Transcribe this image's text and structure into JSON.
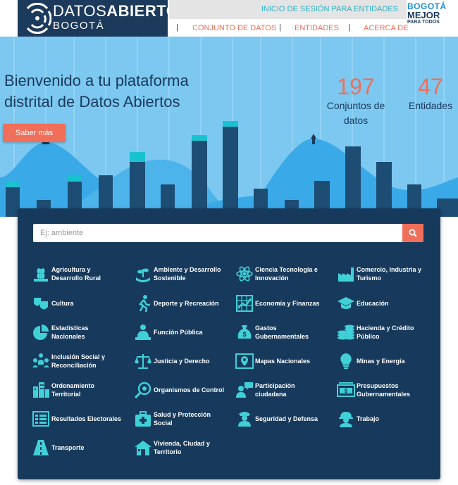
{
  "header": {
    "logo_line1_regular": "DATOS",
    "logo_line1_bold": "ABIERTOS",
    "logo_line2": "BOGOTÁ",
    "login_link": "INICIO DE SESIÓN PARA ENTIDADES",
    "nav": [
      "CONJUNTO DE DATOS",
      "ENTIDADES",
      "ACERCA DE"
    ],
    "badge": {
      "line1": "BOGOTÁ",
      "line2": "MEJOR",
      "line3": "PARA TODOS"
    }
  },
  "hero": {
    "title_line1": "Bienvenido a tu plataforma",
    "title_line2": "distrital de Datos Abiertos",
    "cta_label": "Saber más",
    "stats": [
      {
        "number": "197",
        "label_line1": "Conjuntos de",
        "label_line2": "datos"
      },
      {
        "number": "47",
        "label_line1": "Entidades",
        "label_line2": ""
      }
    ]
  },
  "search": {
    "placeholder": "Ej: ambiente"
  },
  "categories": [
    {
      "l1": "Agricultura y",
      "l2": "Desarrollo Rural",
      "icon": "wheat-icon"
    },
    {
      "l1": "Ambiente y Desarrollo",
      "l2": "Sostenible",
      "icon": "plant-hands-icon"
    },
    {
      "l1": "Ciencia Tecnología e",
      "l2": "Innovación",
      "icon": "atom-icon"
    },
    {
      "l1": "Comercio, Industria y",
      "l2": "Turismo",
      "icon": "factory-icon"
    },
    {
      "l1": "Cultura",
      "l2": "",
      "icon": "theater-masks-icon"
    },
    {
      "l1": "Deporte y Recreación",
      "l2": "",
      "icon": "runner-icon"
    },
    {
      "l1": "Economía y Finanzas",
      "l2": "",
      "icon": "grid-chart-icon"
    },
    {
      "l1": "Educación",
      "l2": "",
      "icon": "graduation-cap-icon"
    },
    {
      "l1": "Estadísticas",
      "l2": "Nacionales",
      "icon": "pie-chart-icon"
    },
    {
      "l1": "Función Pública",
      "l2": "",
      "icon": "public-servant-icon"
    },
    {
      "l1": "Gastos",
      "l2": "Gubernamentales",
      "icon": "money-bag-icon"
    },
    {
      "l1": "Hacienda y Crédito",
      "l2": "Público",
      "icon": "coins-icon"
    },
    {
      "l1": "Inclusión Social y",
      "l2": "Reconciliación",
      "icon": "people-group-icon"
    },
    {
      "l1": "Justicia y Derecho",
      "l2": "",
      "icon": "scales-icon"
    },
    {
      "l1": "Mapas Nacionales",
      "l2": "",
      "icon": "map-pin-icon"
    },
    {
      "l1": "Minas y Energía",
      "l2": "",
      "icon": "lightbulb-icon"
    },
    {
      "l1": "Ordenamiento",
      "l2": "Territorial",
      "icon": "buildings-icon"
    },
    {
      "l1": "Organismos de Control",
      "l2": "",
      "icon": "magnifier-icon"
    },
    {
      "l1": "Participación",
      "l2": "ciudadana",
      "icon": "speech-person-icon"
    },
    {
      "l1": "Presupuestos",
      "l2": "Gubernamentales",
      "icon": "bank-bill-icon"
    },
    {
      "l1": "Resultados Electorales",
      "l2": "",
      "icon": "ballot-list-icon"
    },
    {
      "l1": "Salud y Protección",
      "l2": "Social",
      "icon": "medical-kit-icon"
    },
    {
      "l1": "Seguridad y Defensa",
      "l2": "",
      "icon": "police-officer-icon"
    },
    {
      "l1": "Trabajo",
      "l2": "",
      "icon": "worker-helmet-icon"
    },
    {
      "l1": "Transporte",
      "l2": "",
      "icon": "road-icon"
    },
    {
      "l1": "Vivienda, Ciudad y",
      "l2": "Territorio",
      "icon": "house-icon"
    }
  ],
  "colors": {
    "navy": "#1b3a5c",
    "coral": "#f06f5a",
    "teal": "#2bb0c4",
    "sky": "#7cc8f0",
    "icon": "#3fd0d8"
  }
}
